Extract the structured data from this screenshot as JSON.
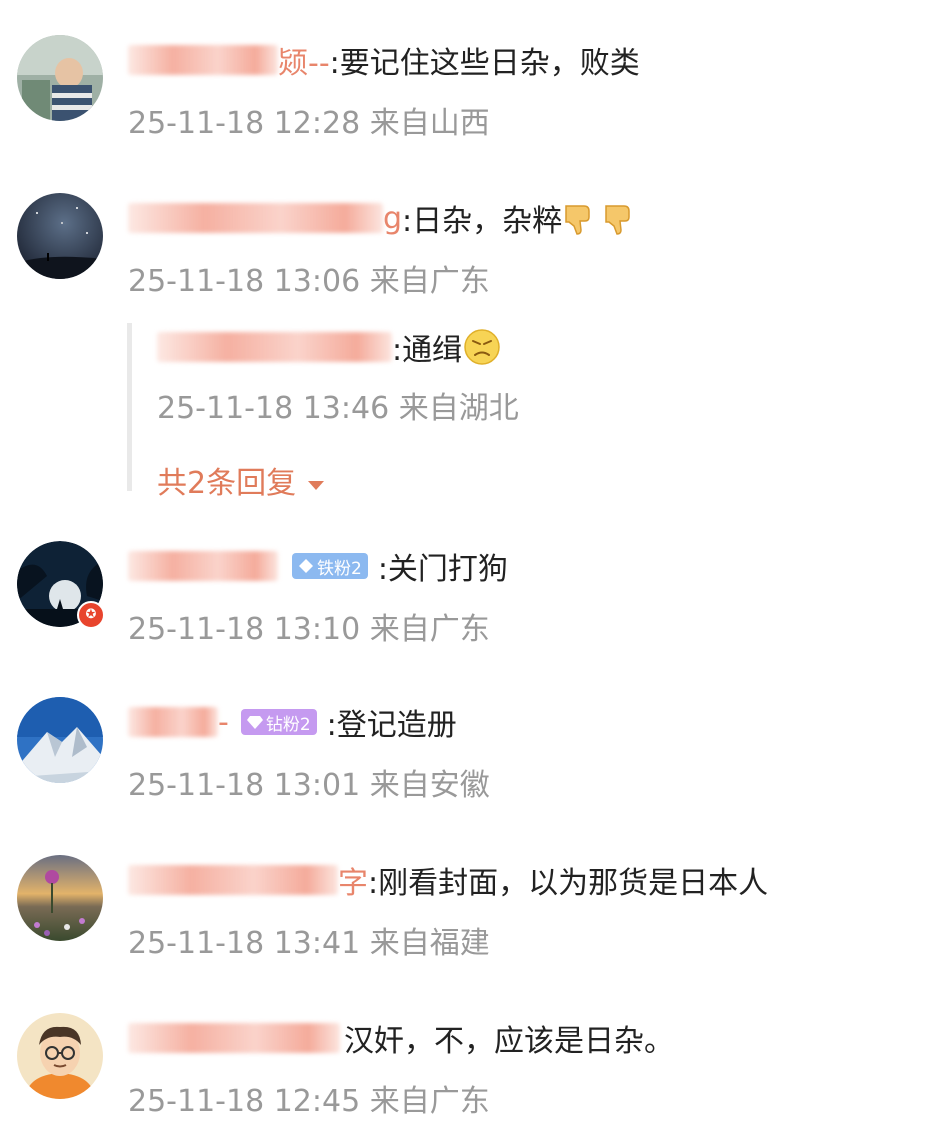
{
  "comments": [
    {
      "avatar_icon": "child-photo-avatar",
      "username_tail": "颎--",
      "text": ":要记住这些日杂，败类",
      "time": "25-11-18 12:28",
      "location": "来自山西"
    },
    {
      "avatar_icon": "night-sky-avatar",
      "username_tail": "g",
      "text": ":日杂，杂粹",
      "emoji": [
        "thumbs-down-emoji",
        "thumbs-down-emoji"
      ],
      "time": "25-11-18 13:06",
      "location": "来自广东",
      "reply": {
        "text": ":通缉",
        "emoji": "angry-face-emoji",
        "time": "25-11-18 13:46",
        "location": "来自湖北",
        "more_label": "共2条回复",
        "more_icon": "caret-down-icon"
      }
    },
    {
      "avatar_icon": "moon-silhouette-avatar",
      "badge": {
        "label": "铁粉2",
        "icon": "diamond-icon",
        "color": "#8cb9f0"
      },
      "text": ":关门打狗",
      "time": "25-11-18 13:10",
      "location": "来自广东"
    },
    {
      "avatar_icon": "snow-mountain-avatar",
      "username_tail": "-",
      "badge": {
        "label": "钻粉2",
        "icon": "gem-icon",
        "color": "#c59af0"
      },
      "text": ":登记造册",
      "time": "25-11-18 13:01",
      "location": "来自安徽"
    },
    {
      "avatar_icon": "flower-field-avatar",
      "username_tail": "字",
      "text": ":刚看封面，以为那货是日本人",
      "time": "25-11-18 13:41",
      "location": "来自福建"
    },
    {
      "avatar_icon": "cartoon-man-avatar",
      "text": "汉奸，不，应该是日杂。",
      "time": "25-11-18 12:45",
      "location": "来自广东"
    }
  ],
  "colors": {
    "username": "#e8856b",
    "meta": "#999999",
    "link": "#e07b5a"
  }
}
